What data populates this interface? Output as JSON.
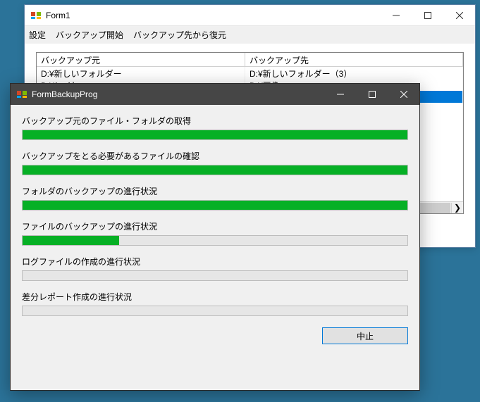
{
  "form1": {
    "title": "Form1",
    "menu": {
      "settings": "設定",
      "start_backup": "バックアップ開始",
      "restore_from_dest": "バックアップ先から復元"
    },
    "table": {
      "headers": {
        "source": "バックアップ元",
        "dest": "バックアップ先"
      },
      "rows": [
        {
          "source": "D:¥新しいフォルダー",
          "dest": "D:¥新しいフォルダー（3）"
        },
        {
          "source": "D:¥レイヤー",
          "dest": "D:¥画像"
        },
        {
          "source": "",
          "dest": ""
        },
        {
          "source": "",
          "dest": ""
        },
        {
          "source": "",
          "dest": ""
        },
        {
          "source": "",
          "dest": ""
        },
        {
          "source": "",
          "dest": ""
        },
        {
          "source": "",
          "dest": ""
        },
        {
          "source": "",
          "dest": ""
        },
        {
          "source": "",
          "dest": ""
        }
      ],
      "scroll_arrow": "❯"
    }
  },
  "form2": {
    "title": "FormBackupProg",
    "progress": [
      {
        "label": "バックアップ元のファイル・フォルダの取得",
        "percent": 100
      },
      {
        "label": "バックアップをとる必要があるファイルの確認",
        "percent": 100
      },
      {
        "label": "フォルダのバックアップの進行状況",
        "percent": 100
      },
      {
        "label": "ファイルのバックアップの進行状況",
        "percent": 25
      },
      {
        "label": "ログファイルの作成の進行状況",
        "percent": 0
      },
      {
        "label": "差分レポート作成の進行状況",
        "percent": 0
      }
    ],
    "cancel": "中止"
  },
  "colors": {
    "progress_green": "#06b025",
    "selection_blue": "#0078d7"
  }
}
